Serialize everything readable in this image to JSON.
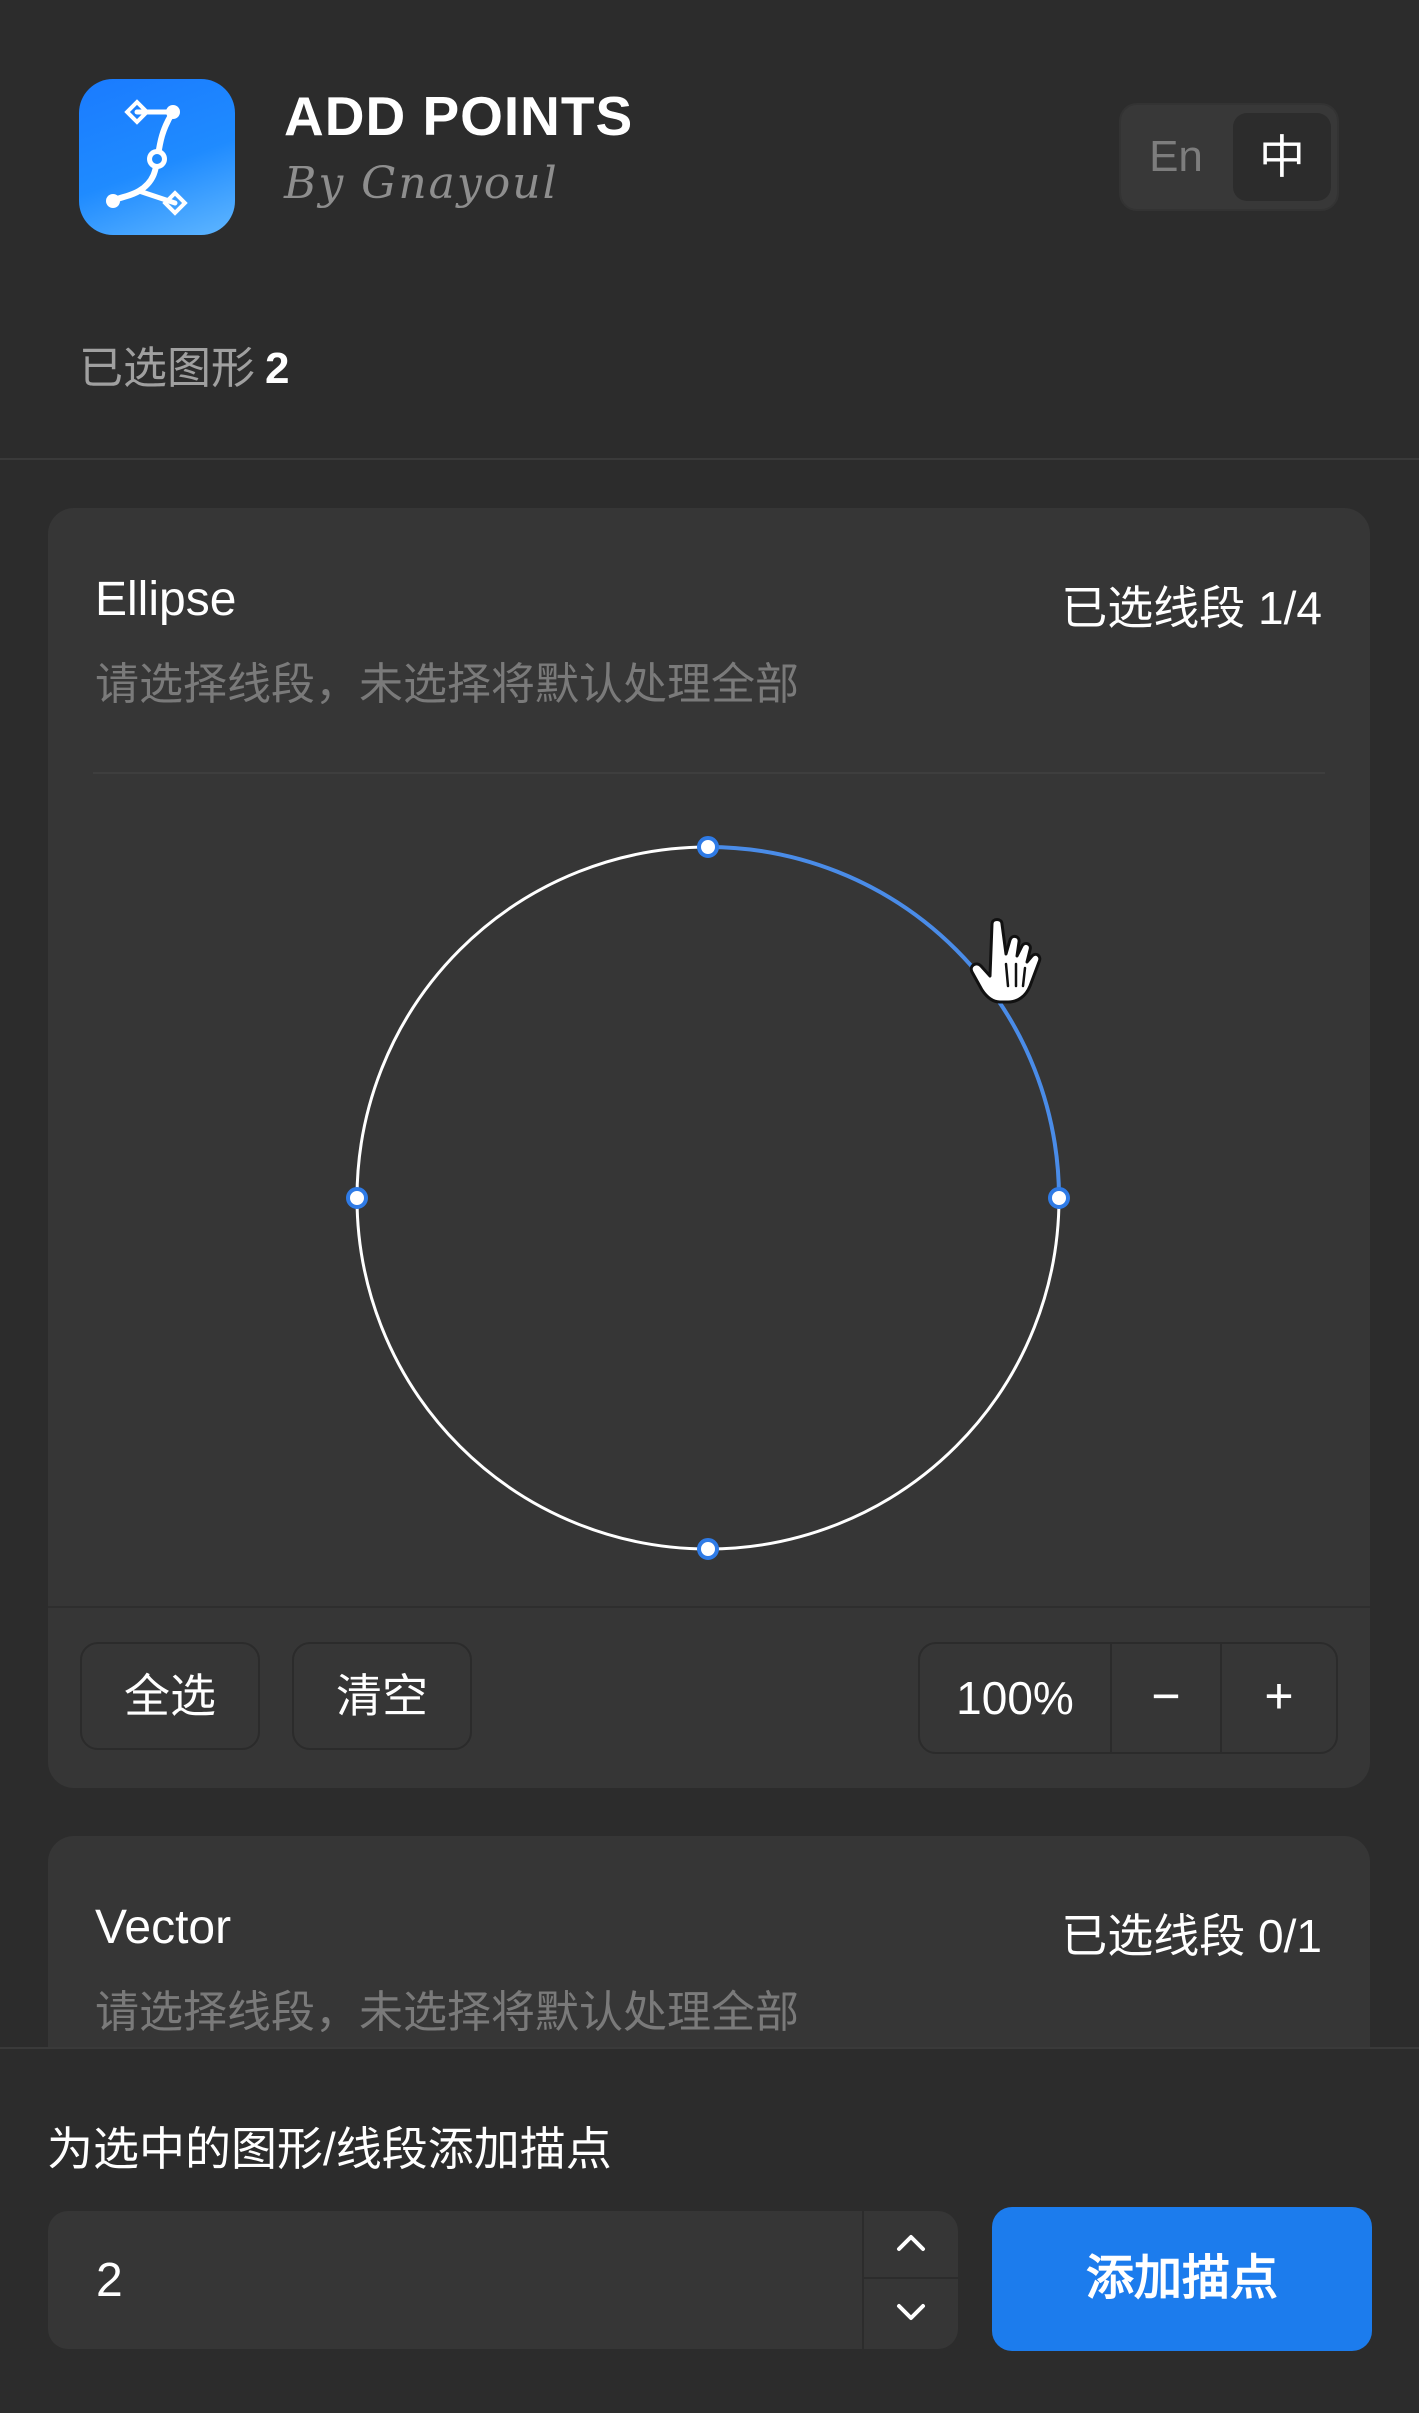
{
  "app": {
    "title": "ADD POINTS",
    "author": "By Gnayoul"
  },
  "language": {
    "options": [
      "En",
      "中"
    ],
    "selected": "中"
  },
  "selection": {
    "label": "已选图形",
    "count": "2"
  },
  "shapes": [
    {
      "name": "Ellipse",
      "segments_label": "已选线段 1/4",
      "hint": "请选择线段，未选择将默认处理全部",
      "selected_segment": "top-right",
      "select_all_label": "全选",
      "clear_label": "清空",
      "zoom": "100%",
      "zoom_out_label": "−",
      "zoom_in_label": "+"
    },
    {
      "name": "Vector",
      "segments_label": "已选线段 0/1",
      "hint": "请选择线段，未选择将默认处理全部"
    }
  ],
  "bottom": {
    "label": "为选中的图形/线段添加描点",
    "count_value": "2",
    "add_button_label": "添加描点"
  },
  "colors": {
    "background": "#2c2c2c",
    "card": "#363636",
    "accent": "#1c7ced",
    "selected_segment": "#4a8ce8",
    "path": "#ffffff"
  },
  "icons": {
    "logo": "bezier-path-icon",
    "cursor": "hand-pointer-icon",
    "step_up": "chevron-up-icon",
    "step_down": "chevron-down-icon"
  }
}
